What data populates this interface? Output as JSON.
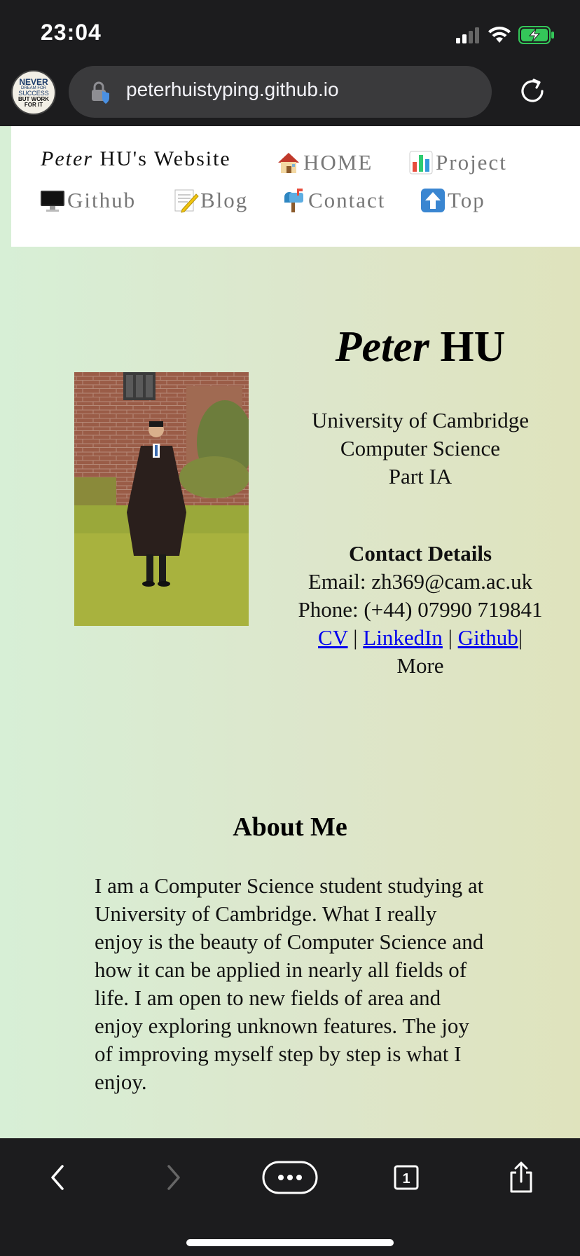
{
  "status_bar": {
    "time": "23:04",
    "icons": [
      "signal-icon",
      "wifi-icon",
      "battery-charging-icon"
    ]
  },
  "browser": {
    "url": "peterhuistyping.github.io",
    "favicon_lines": [
      "NEVER",
      "DREAM FOR",
      "SUCCESS",
      "BUT WORK",
      "FOR IT"
    ]
  },
  "nav": {
    "brand_italic": "Peter",
    "brand_rest": " HU's Website",
    "items": [
      {
        "label": "HOME",
        "icon": "house-icon"
      },
      {
        "label": "Project",
        "icon": "bar-chart-icon"
      },
      {
        "label": "Github",
        "icon": "desktop-computer-icon"
      },
      {
        "label": "Blog",
        "icon": "memo-icon"
      },
      {
        "label": "Contact",
        "icon": "mailbox-icon"
      },
      {
        "label": "Top",
        "icon": "up-arrow-icon"
      }
    ]
  },
  "profile": {
    "name_italic": "Peter",
    "name_rest": " HU",
    "university": "University of Cambridge",
    "subject": "Computer Science",
    "part": "Part IA"
  },
  "contact": {
    "heading": "Contact Details",
    "email": "Email: zh369@cam.ac.uk",
    "phone": "Phone: (+44) 07990 719841",
    "links": {
      "cv": "CV",
      "linkedin": "LinkedIn",
      "github": "Github"
    },
    "separator": " | ",
    "more": "More"
  },
  "about": {
    "title": "About Me",
    "text": "I am a Computer Science student studying at University of Cambridge. What I really enjoy is the beauty of Computer Science and how it can be applied in nearly all fields of life. I am open to new fields of area and enjoy exploring unknown features. The joy of improving myself step by step is what I enjoy."
  },
  "toolbar": {
    "tab_count": "1",
    "buttons": [
      "back-icon",
      "forward-icon",
      "more-icon",
      "tabs-icon",
      "share-icon"
    ]
  },
  "colors": {
    "link": "#0000ee",
    "nav_text": "#777777",
    "page_bg_left": "#d7efd6",
    "page_bg_right": "#dfe3bd"
  }
}
